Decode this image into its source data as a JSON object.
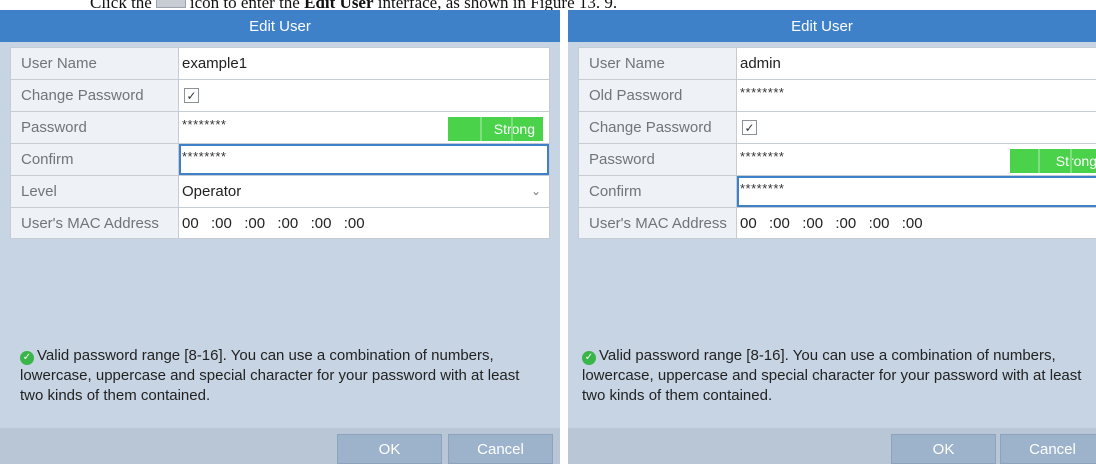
{
  "caption": {
    "pre": "Click the",
    "post": "icon to enter the",
    "bold": "Edit User",
    "tail": "interface, as shown in Figure 13. 9."
  },
  "left_dialog": {
    "title": "Edit User",
    "rows": {
      "user_name": {
        "label": "User Name",
        "value": "example1"
      },
      "change_password": {
        "label": "Change Password",
        "checked": true,
        "mark": "✓"
      },
      "password": {
        "label": "Password",
        "value": "********",
        "strength": "Strong"
      },
      "confirm": {
        "label": "Confirm",
        "value": "********"
      },
      "level": {
        "label": "Level",
        "value": "Operator"
      },
      "mac": {
        "label": "User's MAC Address",
        "value": "00  :00  :00  :00  :00  :00"
      }
    },
    "hint": "Valid password range [8-16]. You can use a combination of numbers, lowercase, uppercase and special character for your password with at least two kinds of them contained.",
    "buttons": {
      "ok": "OK",
      "cancel": "Cancel"
    }
  },
  "right_dialog": {
    "title": "Edit User",
    "rows": {
      "user_name": {
        "label": "User Name",
        "value": "admin"
      },
      "old_password": {
        "label": "Old Password",
        "value": "********"
      },
      "change_password": {
        "label": "Change Password",
        "checked": true,
        "mark": "✓"
      },
      "password": {
        "label": "Password",
        "value": "********",
        "strength": "Strong"
      },
      "confirm": {
        "label": "Confirm",
        "value": "********"
      },
      "mac": {
        "label": "User's MAC Address",
        "value": "00  :00  :00  :00  :00  :00"
      }
    },
    "hint": "Valid password range [8-16]. You can use a combination of numbers, lowercase, uppercase and special character for your password with at least two kinds of them contained.",
    "buttons": {
      "ok": "OK",
      "cancel": "Cancel"
    }
  },
  "icons": {
    "dropdown": "chevron-down-icon",
    "hint": "check-circle-icon",
    "edit": "edit-icon"
  },
  "colors": {
    "title_bar": "#3f81c9",
    "dialog_bg": "#c7d4e3",
    "strength": "#4ad34a",
    "button": "#9db2cb"
  }
}
